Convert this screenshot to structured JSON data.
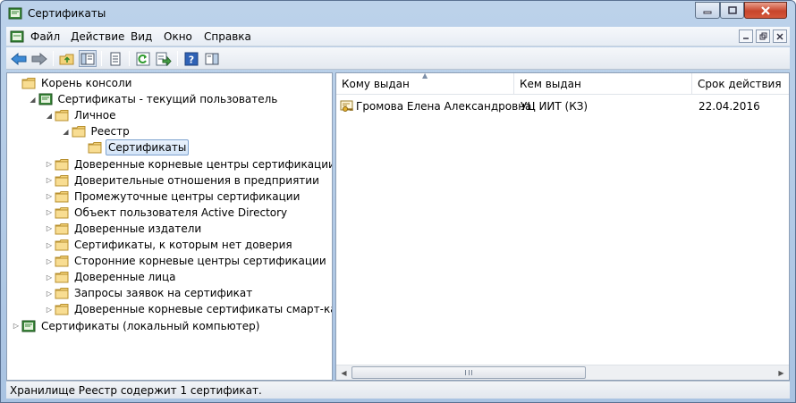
{
  "window": {
    "title": "Сертификаты"
  },
  "menubar": {
    "items": [
      "Файл",
      "Действие",
      "Вид",
      "Окно",
      "Справка"
    ]
  },
  "tree": {
    "items": [
      {
        "label": "Корень консоли",
        "icon": "folder-icon",
        "expanded": true
      },
      {
        "label": "Сертификаты - текущий пользователь",
        "icon": "certificate-snapin-icon",
        "expanded": true
      },
      {
        "label": "Личное",
        "icon": "folder-icon",
        "expanded": true
      },
      {
        "label": "Реестр",
        "icon": "folder-icon",
        "expanded": true
      },
      {
        "label": "Сертификаты",
        "icon": "folder-icon",
        "selected": true
      },
      {
        "label": "Доверенные корневые центры сертификации",
        "icon": "folder-icon",
        "expanded": false
      },
      {
        "label": "Доверительные отношения в предприятии",
        "icon": "folder-icon",
        "expanded": false
      },
      {
        "label": "Промежуточные центры сертификации",
        "icon": "folder-icon",
        "expanded": false
      },
      {
        "label": "Объект пользователя Active Directory",
        "icon": "folder-icon",
        "expanded": false
      },
      {
        "label": "Доверенные издатели",
        "icon": "folder-icon",
        "expanded": false
      },
      {
        "label": "Сертификаты, к которым нет доверия",
        "icon": "folder-icon",
        "expanded": false
      },
      {
        "label": "Сторонние корневые центры сертификации",
        "icon": "folder-icon",
        "expanded": false
      },
      {
        "label": "Доверенные лица",
        "icon": "folder-icon",
        "expanded": false
      },
      {
        "label": "Запросы заявок на сертификат",
        "icon": "folder-icon",
        "expanded": false
      },
      {
        "label": "Доверенные корневые сертификаты смарт-карты",
        "icon": "folder-icon",
        "expanded": false
      },
      {
        "label": "Сертификаты (локальный компьютер)",
        "icon": "certificate-snapin-icon",
        "expanded": false
      }
    ]
  },
  "list": {
    "columns": [
      "Кому выдан",
      "Кем выдан",
      "Срок действия"
    ],
    "rows": [
      {
        "issued_to": "Громова Елена Александровна",
        "issued_by": "УЦ ИИТ (КЗ)",
        "expiry": "22.04.2016",
        "icon": "certificate-key-icon"
      }
    ]
  },
  "statusbar": {
    "text": "Хранилище Реестр содержит 1 сертификат."
  },
  "colors": {
    "titlebar": "#bcd2ea",
    "selection": "#d3e4f7",
    "folder": "#f3d27a",
    "close_button": "#c8452c"
  }
}
